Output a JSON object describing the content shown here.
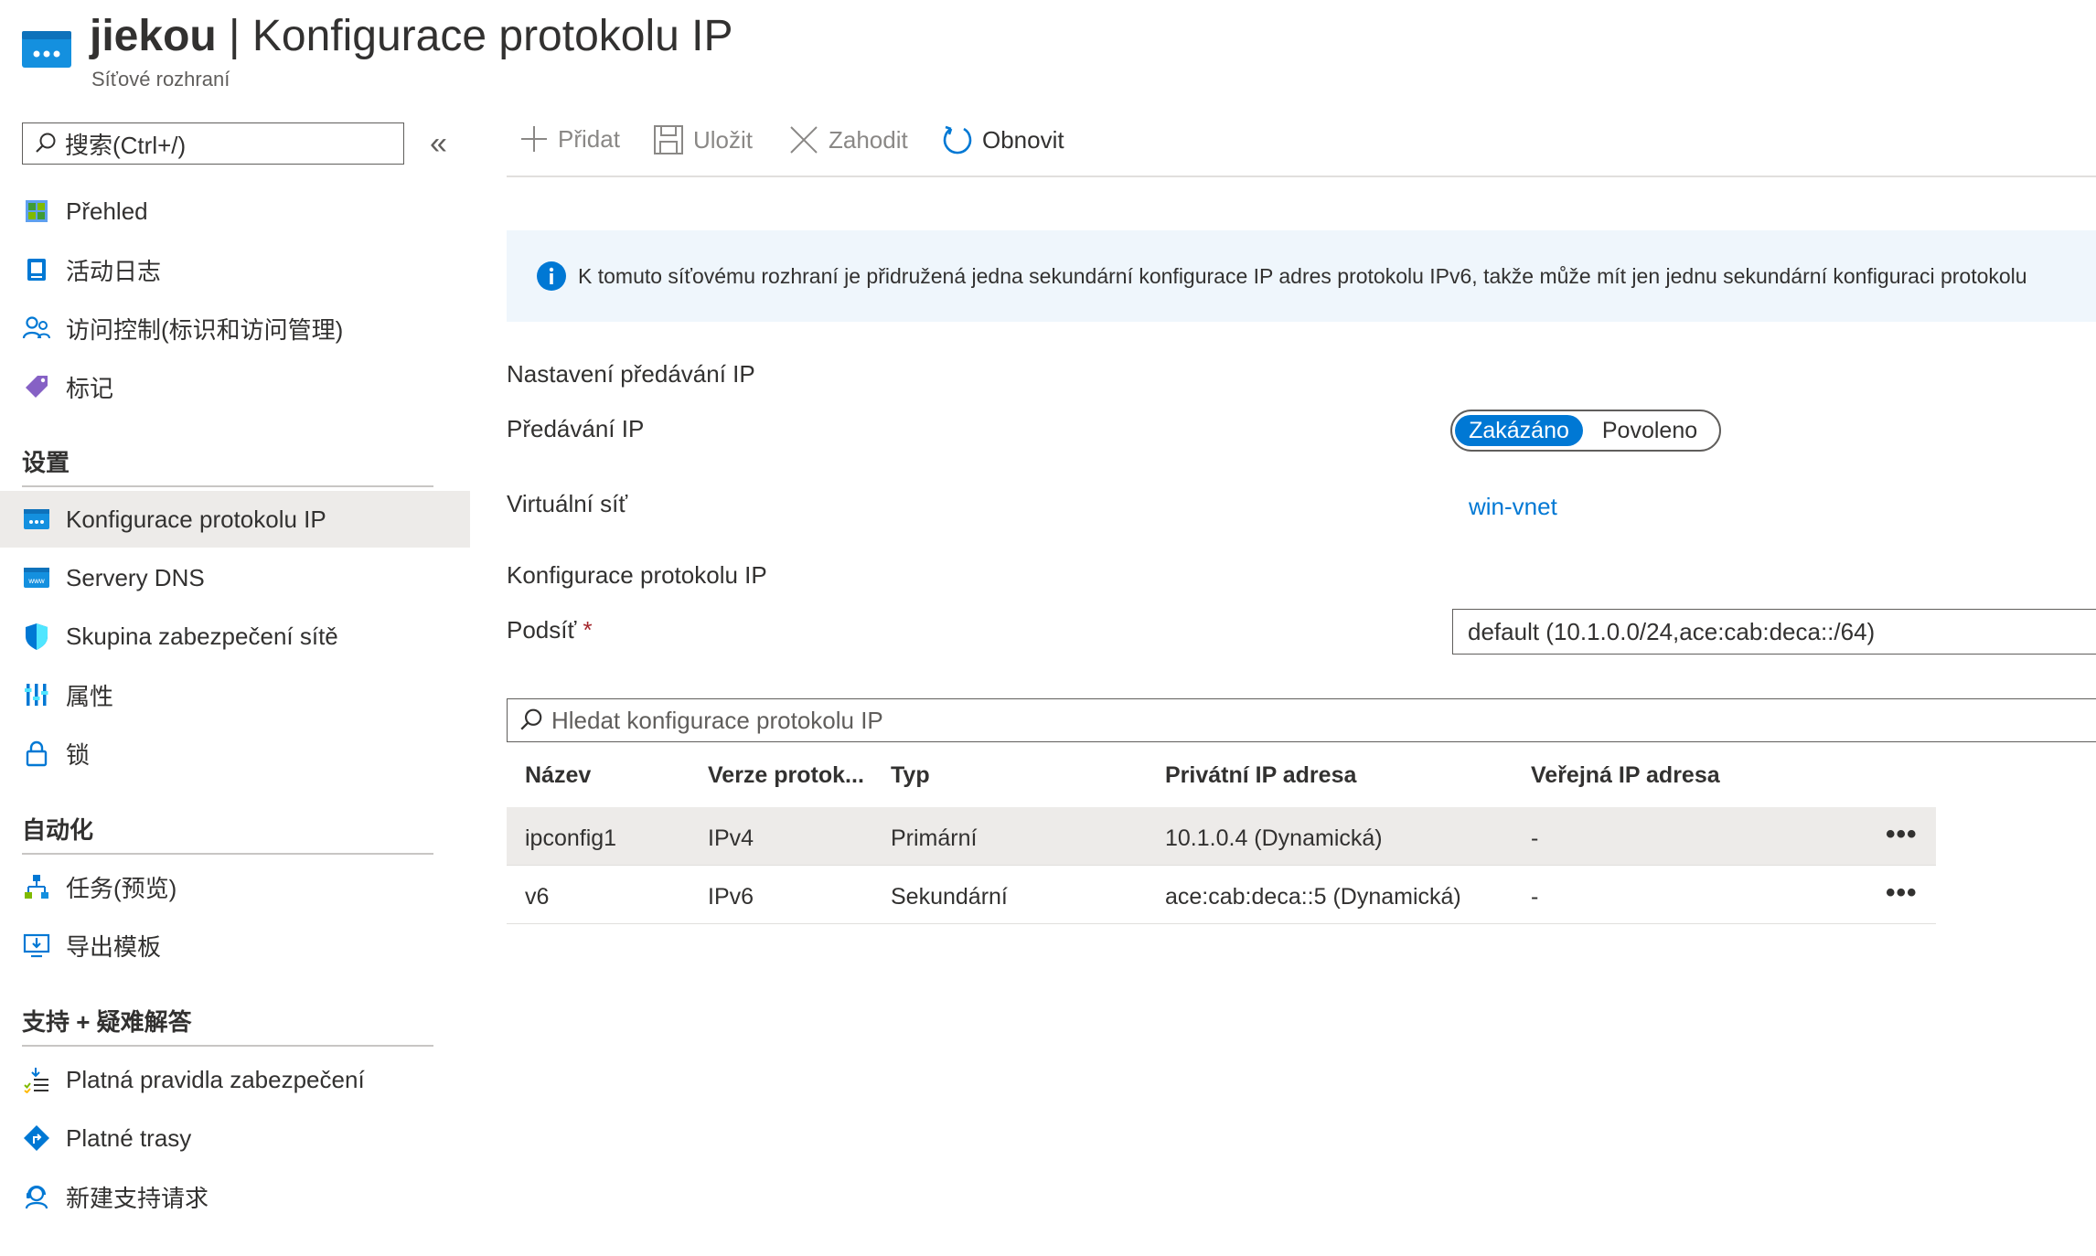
{
  "header": {
    "resource_name": "jiekou",
    "separator": "|",
    "page_title": "Konfigurace protokolu IP",
    "subtitle": "Síťové rozhraní"
  },
  "sidebar": {
    "search_placeholder": "搜索(Ctrl+/)",
    "collapse_label": "«",
    "top_items": [
      {
        "label": "Přehled",
        "icon": "overview-icon"
      },
      {
        "label": "活动日志",
        "icon": "activity-log-icon"
      },
      {
        "label": "访问控制(标识和访问管理)",
        "icon": "access-control-icon"
      },
      {
        "label": "标记",
        "icon": "tag-icon"
      }
    ],
    "section_settings": "设置",
    "settings_items": [
      {
        "label": "Konfigurace protokolu IP",
        "icon": "ip-config-icon",
        "active": true
      },
      {
        "label": "Servery DNS",
        "icon": "dns-icon"
      },
      {
        "label": "Skupina zabezpečení sítě",
        "icon": "shield-icon"
      },
      {
        "label": "属性",
        "icon": "properties-icon"
      },
      {
        "label": "锁",
        "icon": "lock-icon"
      }
    ],
    "section_automation": "自动化",
    "automation_items": [
      {
        "label": "任务(预览)",
        "icon": "tasks-icon"
      },
      {
        "label": "导出模板",
        "icon": "export-template-icon"
      }
    ],
    "section_support": "支持 + 疑难解答",
    "support_items": [
      {
        "label": "Platná pravidla zabezpečení",
        "icon": "security-rules-icon"
      },
      {
        "label": "Platné trasy",
        "icon": "routes-icon"
      },
      {
        "label": "新建支持请求",
        "icon": "support-request-icon"
      }
    ]
  },
  "toolbar": {
    "add": "Přidat",
    "save": "Uložit",
    "discard": "Zahodit",
    "refresh": "Obnovit"
  },
  "banner": {
    "text": "K tomuto síťovému rozhraní je přidružená jedna sekundární konfigurace IP adres protokolu IPv6, takže může mít jen jednu sekundární konfiguraci protokolu"
  },
  "forwarding": {
    "section_title": "Nastavení předávání IP",
    "label": "Předávání IP",
    "option_disabled": "Zakázáno",
    "option_enabled": "Povoleno",
    "selected": "Zakázáno"
  },
  "vnet": {
    "label": "Virtuální síť",
    "value": "win-vnet"
  },
  "ipconfig": {
    "section_title": "Konfigurace protokolu IP",
    "subnet_label": "Podsíť",
    "required_mark": "*",
    "subnet_value": "default (10.1.0.0/24,ace:cab:deca::/64)",
    "search_placeholder": "Hledat konfigurace protokolu IP"
  },
  "table": {
    "columns": [
      "Název",
      "Verze protok...",
      "Typ",
      "Privátní IP adresa",
      "Veřejná IP adresa"
    ],
    "rows": [
      {
        "name": "ipconfig1",
        "version": "IPv4",
        "type": "Primární",
        "private_ip": "10.1.0.4 (Dynamická)",
        "public_ip": "-",
        "more": "•••"
      },
      {
        "name": "v6",
        "version": "IPv6",
        "type": "Sekundární",
        "private_ip": "ace:cab:deca::5 (Dynamická)",
        "public_ip": "-",
        "more": "•••"
      }
    ]
  },
  "colors": {
    "accent": "#0078d4",
    "selected_row": "#edebe9",
    "banner_bg": "#eff6fc",
    "required": "#a4262c"
  }
}
